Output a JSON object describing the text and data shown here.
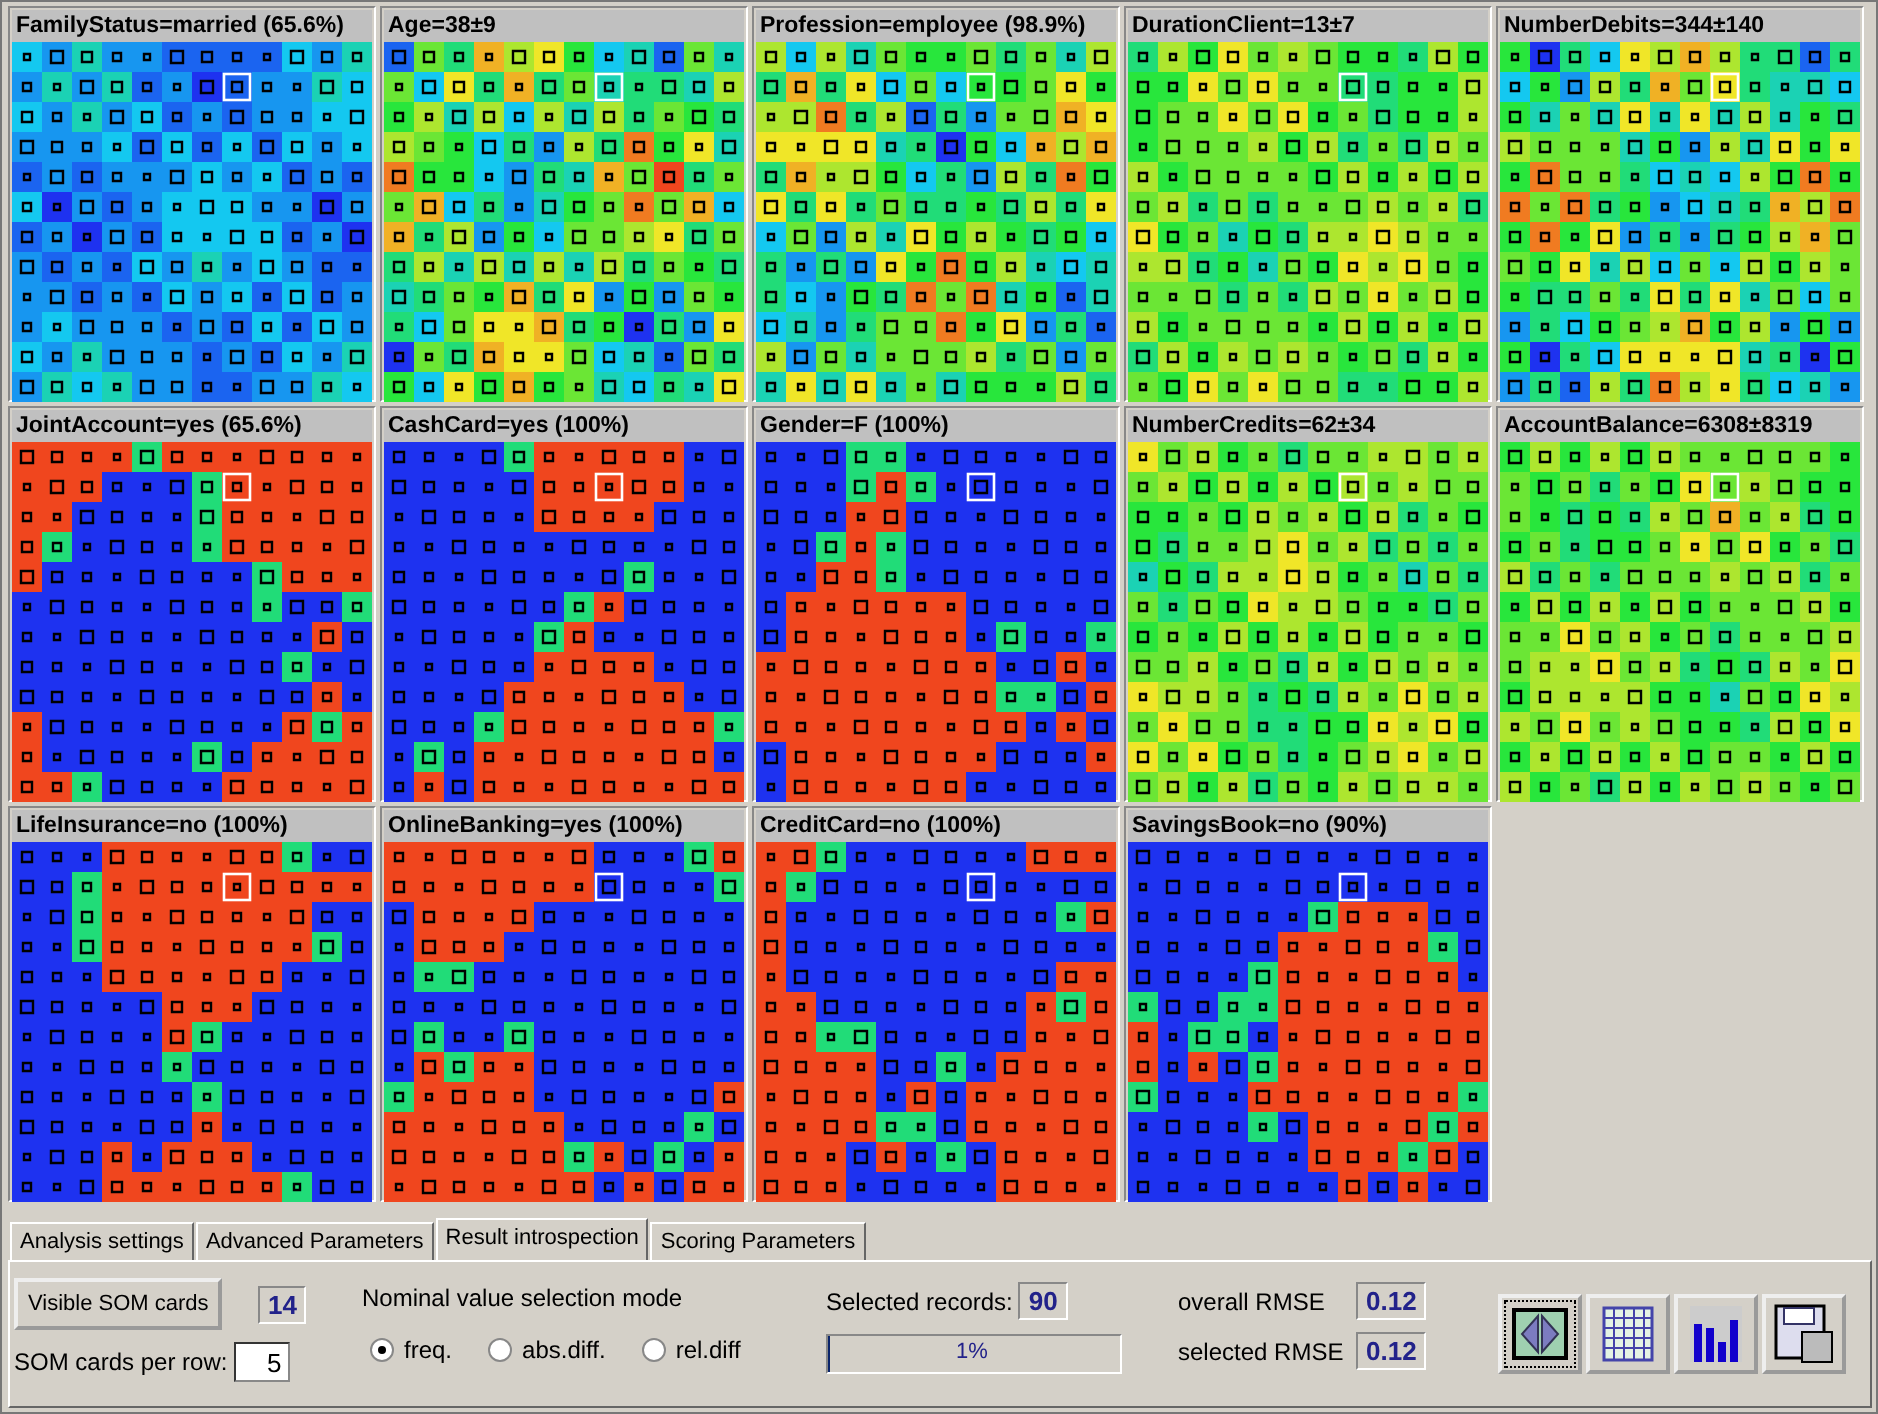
{
  "cards": [
    {
      "title": "FamilyStatus=married (65.6%)",
      "kind": "low"
    },
    {
      "title": "Age=38±9",
      "kind": "mixed"
    },
    {
      "title": "Profession=employee (98.9%)",
      "kind": "mixed"
    },
    {
      "title": "DurationClient=13±7",
      "kind": "mid"
    },
    {
      "title": "NumberDebits=344±140",
      "kind": "mixed"
    },
    {
      "title": "JointAccount=yes (65.6%)",
      "kind": "binary"
    },
    {
      "title": "CashCard=yes (100%)",
      "kind": "binary"
    },
    {
      "title": "Gender=F (100%)",
      "kind": "binary"
    },
    {
      "title": "NumberCredits=62±34",
      "kind": "mid"
    },
    {
      "title": "AccountBalance=6308±8319",
      "kind": "mid"
    },
    {
      "title": "LifeInsurance=no (100%)",
      "kind": "binary"
    },
    {
      "title": "OnlineBanking=yes (100%)",
      "kind": "binary"
    },
    {
      "title": "CreditCard=no (100%)",
      "kind": "binary"
    },
    {
      "title": "SavingsBook=no (90%)",
      "kind": "binary"
    }
  ],
  "tabs": [
    {
      "label": "Analysis settings",
      "selected": false
    },
    {
      "label": "Advanced Parameters",
      "selected": false
    },
    {
      "label": "Result introspection",
      "selected": true
    },
    {
      "label": "Scoring Parameters",
      "selected": false
    }
  ],
  "visible_button": "Visible SOM cards",
  "visible_count": "14",
  "per_row_label": "SOM cards per row:",
  "per_row_value": "5",
  "mode_label": "Nominal value selection mode",
  "modes": [
    {
      "label": "freq.",
      "selected": true
    },
    {
      "label": "abs.diff.",
      "selected": false
    },
    {
      "label": "rel.diff",
      "selected": false
    }
  ],
  "selected_records_label": "Selected records:",
  "selected_records": "90",
  "progress": {
    "label": "1%",
    "level": 0.01
  },
  "overall_rmse_label": "overall RMSE",
  "overall_rmse": "0.12",
  "selected_rmse_label": "selected RMSE",
  "selected_rmse": "0.12",
  "tool_buttons": [
    {
      "kind": "split"
    },
    {
      "kind": "table"
    },
    {
      "kind": "bars"
    },
    {
      "kind": "save"
    }
  ]
}
